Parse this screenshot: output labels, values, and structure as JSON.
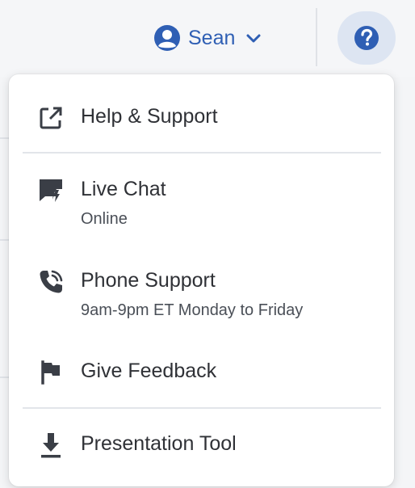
{
  "header": {
    "user_name": "Sean"
  },
  "menu": {
    "help_support": {
      "label": "Help & Support"
    },
    "live_chat": {
      "label": "Live Chat",
      "status": "Online"
    },
    "phone_support": {
      "label": "Phone Support",
      "hours": "9am-9pm ET Monday to Friday"
    },
    "give_feedback": {
      "label": "Give Feedback"
    },
    "presentation_tool": {
      "label": "Presentation Tool"
    }
  },
  "colors": {
    "accent_blue": "#2f5fb4",
    "help_button_bg": "#dde5f2",
    "icon_dark": "#3a3e46",
    "menu_bg": "#ffffff"
  },
  "icons": {
    "user": "user-circle-icon",
    "chevron": "chevron-down-icon",
    "help": "question-circle-icon",
    "help_support": "external-link-icon",
    "live_chat": "chat-bubble-icon",
    "phone_support": "phone-call-icon",
    "give_feedback": "flag-icon",
    "presentation_tool": "download-icon"
  }
}
